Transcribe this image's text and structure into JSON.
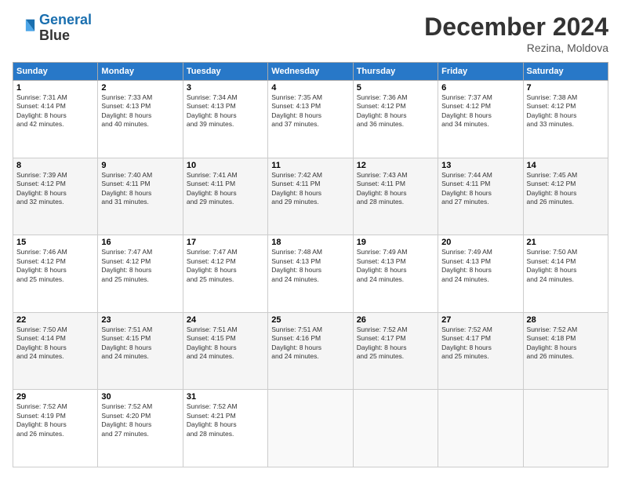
{
  "header": {
    "logo_line1": "General",
    "logo_line2": "Blue",
    "month": "December 2024",
    "location": "Rezina, Moldova"
  },
  "weekdays": [
    "Sunday",
    "Monday",
    "Tuesday",
    "Wednesday",
    "Thursday",
    "Friday",
    "Saturday"
  ],
  "weeks": [
    [
      {
        "day": "1",
        "info": "Sunrise: 7:31 AM\nSunset: 4:14 PM\nDaylight: 8 hours\nand 42 minutes."
      },
      {
        "day": "2",
        "info": "Sunrise: 7:33 AM\nSunset: 4:13 PM\nDaylight: 8 hours\nand 40 minutes."
      },
      {
        "day": "3",
        "info": "Sunrise: 7:34 AM\nSunset: 4:13 PM\nDaylight: 8 hours\nand 39 minutes."
      },
      {
        "day": "4",
        "info": "Sunrise: 7:35 AM\nSunset: 4:13 PM\nDaylight: 8 hours\nand 37 minutes."
      },
      {
        "day": "5",
        "info": "Sunrise: 7:36 AM\nSunset: 4:12 PM\nDaylight: 8 hours\nand 36 minutes."
      },
      {
        "day": "6",
        "info": "Sunrise: 7:37 AM\nSunset: 4:12 PM\nDaylight: 8 hours\nand 34 minutes."
      },
      {
        "day": "7",
        "info": "Sunrise: 7:38 AM\nSunset: 4:12 PM\nDaylight: 8 hours\nand 33 minutes."
      }
    ],
    [
      {
        "day": "8",
        "info": "Sunrise: 7:39 AM\nSunset: 4:12 PM\nDaylight: 8 hours\nand 32 minutes."
      },
      {
        "day": "9",
        "info": "Sunrise: 7:40 AM\nSunset: 4:11 PM\nDaylight: 8 hours\nand 31 minutes."
      },
      {
        "day": "10",
        "info": "Sunrise: 7:41 AM\nSunset: 4:11 PM\nDaylight: 8 hours\nand 29 minutes."
      },
      {
        "day": "11",
        "info": "Sunrise: 7:42 AM\nSunset: 4:11 PM\nDaylight: 8 hours\nand 29 minutes."
      },
      {
        "day": "12",
        "info": "Sunrise: 7:43 AM\nSunset: 4:11 PM\nDaylight: 8 hours\nand 28 minutes."
      },
      {
        "day": "13",
        "info": "Sunrise: 7:44 AM\nSunset: 4:11 PM\nDaylight: 8 hours\nand 27 minutes."
      },
      {
        "day": "14",
        "info": "Sunrise: 7:45 AM\nSunset: 4:12 PM\nDaylight: 8 hours\nand 26 minutes."
      }
    ],
    [
      {
        "day": "15",
        "info": "Sunrise: 7:46 AM\nSunset: 4:12 PM\nDaylight: 8 hours\nand 25 minutes."
      },
      {
        "day": "16",
        "info": "Sunrise: 7:47 AM\nSunset: 4:12 PM\nDaylight: 8 hours\nand 25 minutes."
      },
      {
        "day": "17",
        "info": "Sunrise: 7:47 AM\nSunset: 4:12 PM\nDaylight: 8 hours\nand 25 minutes."
      },
      {
        "day": "18",
        "info": "Sunrise: 7:48 AM\nSunset: 4:13 PM\nDaylight: 8 hours\nand 24 minutes."
      },
      {
        "day": "19",
        "info": "Sunrise: 7:49 AM\nSunset: 4:13 PM\nDaylight: 8 hours\nand 24 minutes."
      },
      {
        "day": "20",
        "info": "Sunrise: 7:49 AM\nSunset: 4:13 PM\nDaylight: 8 hours\nand 24 minutes."
      },
      {
        "day": "21",
        "info": "Sunrise: 7:50 AM\nSunset: 4:14 PM\nDaylight: 8 hours\nand 24 minutes."
      }
    ],
    [
      {
        "day": "22",
        "info": "Sunrise: 7:50 AM\nSunset: 4:14 PM\nDaylight: 8 hours\nand 24 minutes."
      },
      {
        "day": "23",
        "info": "Sunrise: 7:51 AM\nSunset: 4:15 PM\nDaylight: 8 hours\nand 24 minutes."
      },
      {
        "day": "24",
        "info": "Sunrise: 7:51 AM\nSunset: 4:15 PM\nDaylight: 8 hours\nand 24 minutes."
      },
      {
        "day": "25",
        "info": "Sunrise: 7:51 AM\nSunset: 4:16 PM\nDaylight: 8 hours\nand 24 minutes."
      },
      {
        "day": "26",
        "info": "Sunrise: 7:52 AM\nSunset: 4:17 PM\nDaylight: 8 hours\nand 25 minutes."
      },
      {
        "day": "27",
        "info": "Sunrise: 7:52 AM\nSunset: 4:17 PM\nDaylight: 8 hours\nand 25 minutes."
      },
      {
        "day": "28",
        "info": "Sunrise: 7:52 AM\nSunset: 4:18 PM\nDaylight: 8 hours\nand 26 minutes."
      }
    ],
    [
      {
        "day": "29",
        "info": "Sunrise: 7:52 AM\nSunset: 4:19 PM\nDaylight: 8 hours\nand 26 minutes."
      },
      {
        "day": "30",
        "info": "Sunrise: 7:52 AM\nSunset: 4:20 PM\nDaylight: 8 hours\nand 27 minutes."
      },
      {
        "day": "31",
        "info": "Sunrise: 7:52 AM\nSunset: 4:21 PM\nDaylight: 8 hours\nand 28 minutes."
      },
      null,
      null,
      null,
      null
    ]
  ]
}
